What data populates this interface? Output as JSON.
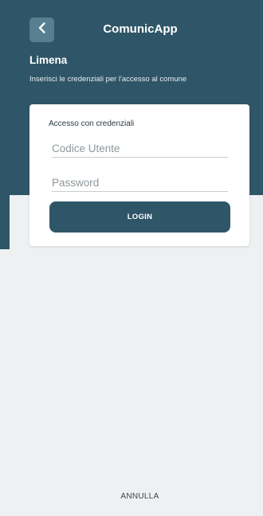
{
  "header": {
    "app_title": "ComunicApp",
    "back_icon": "chevron-left-icon",
    "town_name": "Limena",
    "subtitle": "Inserisci le credenziali per l'accesso al comune"
  },
  "login_card": {
    "title": "Accesso con credenziali",
    "user_field": {
      "placeholder": "Codice Utente",
      "value": ""
    },
    "password_field": {
      "placeholder": "Password",
      "value": ""
    },
    "login_label": "LOGIN"
  },
  "footer": {
    "cancel_label": "ANNULLA"
  },
  "colors": {
    "primary": "#2f5668",
    "back_button": "#587f90",
    "background": "#eef1f2",
    "card": "#ffffff"
  }
}
